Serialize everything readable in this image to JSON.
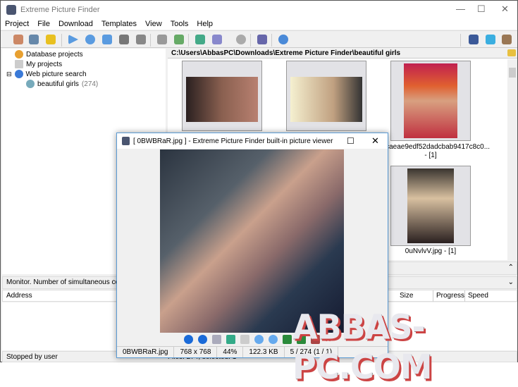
{
  "app": {
    "title": "Extreme Picture Finder"
  },
  "menu": [
    "Project",
    "File",
    "Download",
    "Templates",
    "View",
    "Tools",
    "Help"
  ],
  "tree": [
    {
      "label": "Database projects"
    },
    {
      "label": "My projects"
    },
    {
      "label": "Web picture search"
    },
    {
      "label": "beautiful girls",
      "count": "(274)"
    }
  ],
  "path": "C:\\Users\\AbbasPC\\Downloads\\Extreme Picture Finder\\beautiful girls",
  "thumbs": [
    {
      "caption": "18caeae9edf52dadcbab9417c8c0...",
      "sub": "- [1]"
    },
    {
      "caption": "0uNvlvV.jpg - [1]"
    }
  ],
  "monitor": "Monitor. Number of simultaneous connections",
  "columns": [
    "Address",
    "Size",
    "Progress",
    "Speed"
  ],
  "status": {
    "left": "Stopped by user",
    "files": "Files: 274, selected: 1"
  },
  "viewer": {
    "title": "[ 0BWBRaR.jpg ] - Extreme Picture Finder built-in picture viewer",
    "file": "0BWBRaR.jpg",
    "dims": "768 x 768",
    "zoom": "44%",
    "size": "122.3 KB",
    "pos": "5 / 274 (1 / 1)"
  },
  "watermark": "ABBAS-PC.COM"
}
